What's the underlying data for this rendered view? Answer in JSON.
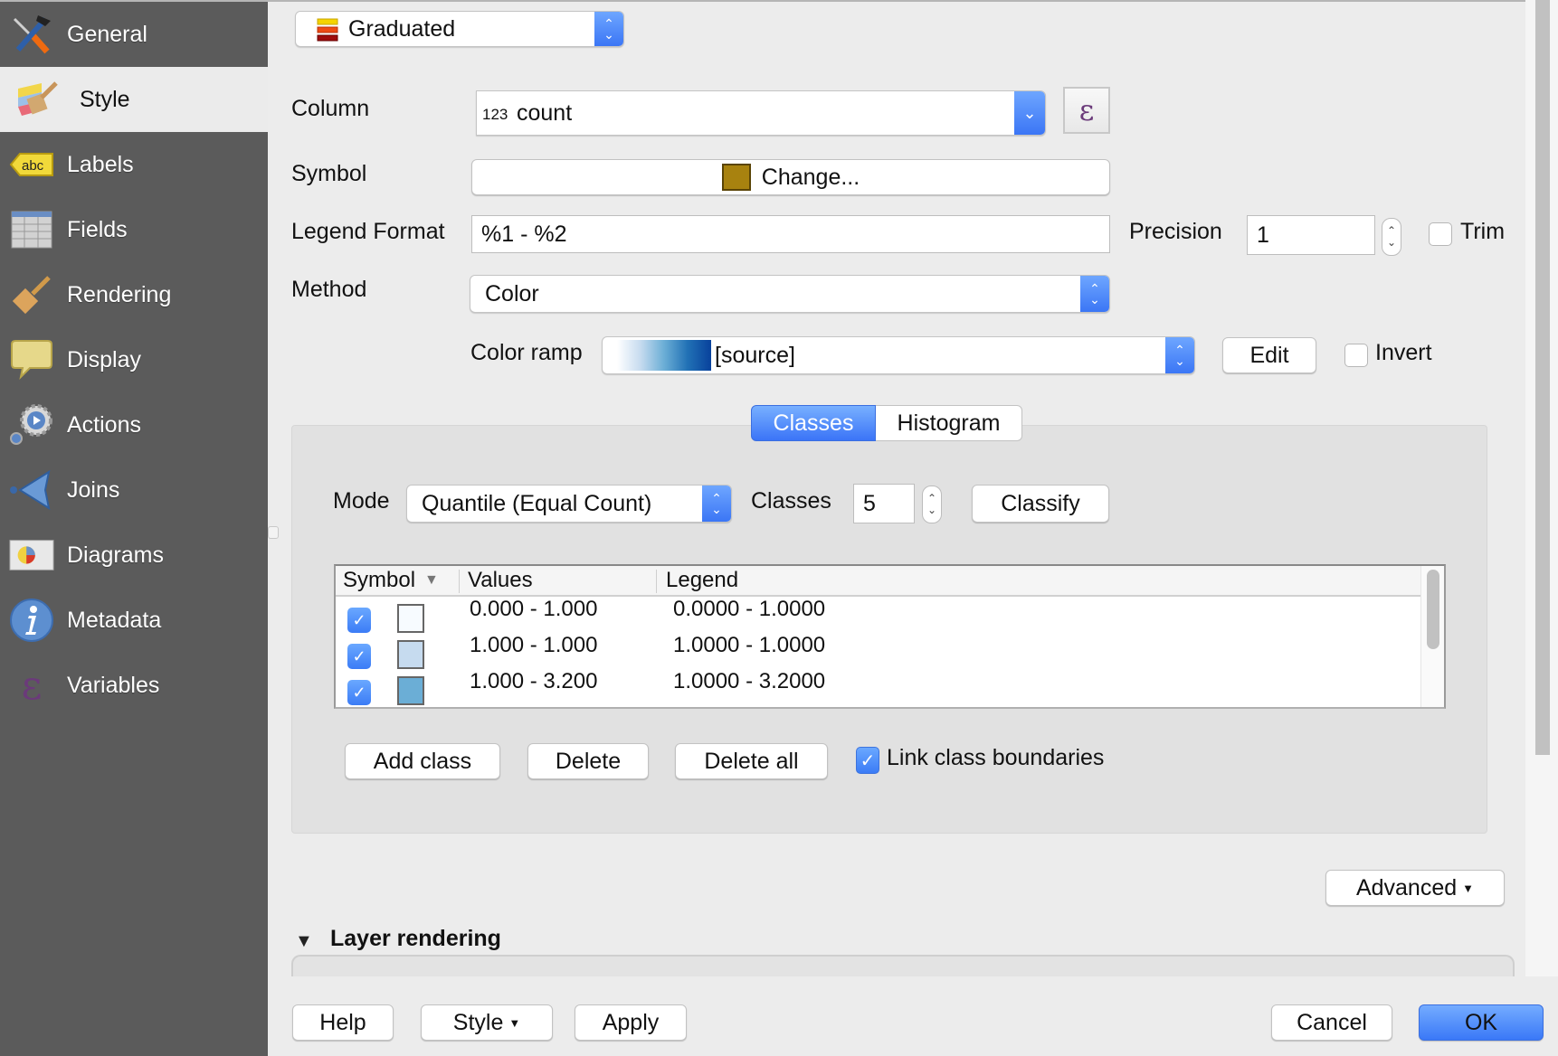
{
  "sidebar": {
    "items": [
      {
        "label": "General",
        "icon": "tools-icon"
      },
      {
        "label": "Style",
        "icon": "paintbrush-style-icon",
        "active": true
      },
      {
        "label": "Labels",
        "icon": "abc-label-icon"
      },
      {
        "label": "Fields",
        "icon": "table-fields-icon"
      },
      {
        "label": "Rendering",
        "icon": "brush-icon"
      },
      {
        "label": "Display",
        "icon": "speech-bubble-icon"
      },
      {
        "label": "Actions",
        "icon": "gear-action-icon"
      },
      {
        "label": "Joins",
        "icon": "join-arrow-icon"
      },
      {
        "label": "Diagrams",
        "icon": "pie-diagram-icon"
      },
      {
        "label": "Metadata",
        "icon": "info-icon"
      },
      {
        "label": "Variables",
        "icon": "epsilon-icon"
      }
    ]
  },
  "renderer": {
    "selected": "Graduated"
  },
  "form": {
    "column_label": "Column",
    "column_type_badge": "123",
    "column_value": "count",
    "expression_symbol": "ε",
    "symbol_label": "Symbol",
    "symbol_button": "Change...",
    "symbol_color": "#a8820f",
    "legend_format_label": "Legend Format",
    "legend_format_value": "%1 - %2",
    "precision_label": "Precision",
    "precision_value": "1",
    "trim_label": "Trim",
    "trim_checked": false,
    "method_label": "Method",
    "method_value": "Color",
    "color_ramp_label": "Color ramp",
    "color_ramp_value": "[source]",
    "edit_button": "Edit",
    "invert_label": "Invert",
    "invert_checked": false
  },
  "tabs": {
    "classes": "Classes",
    "histogram": "Histogram",
    "active": "Classes"
  },
  "classes_panel": {
    "mode_label": "Mode",
    "mode_value": "Quantile (Equal Count)",
    "classes_label": "Classes",
    "classes_value": "5",
    "classify_button": "Classify",
    "table": {
      "headers": {
        "symbol": "Symbol",
        "values": "Values",
        "legend": "Legend"
      },
      "rows": [
        {
          "checked": true,
          "color": "#f7fbff",
          "values": "0.000 - 1.000",
          "legend": "0.0000 - 1.0000"
        },
        {
          "checked": true,
          "color": "#c6dbef",
          "values": "1.000 - 1.000",
          "legend": "1.0000 - 1.0000"
        },
        {
          "checked": true,
          "color": "#6baed6",
          "values": "1.000 - 3.200",
          "legend": "1.0000 - 3.2000"
        }
      ]
    },
    "add_class_button": "Add class",
    "delete_button": "Delete",
    "delete_all_button": "Delete all",
    "link_boundaries_label": "Link class boundaries",
    "link_boundaries_checked": true
  },
  "advanced_button": "Advanced",
  "layer_rendering_label": "Layer rendering",
  "footer": {
    "help": "Help",
    "style": "Style",
    "apply": "Apply",
    "cancel": "Cancel",
    "ok": "OK"
  },
  "colors": {
    "accent": "#3b7cf6",
    "sidebar_bg": "#5b5b5b",
    "ramp_start": "#f7fbff",
    "ramp_end": "#08519c"
  }
}
